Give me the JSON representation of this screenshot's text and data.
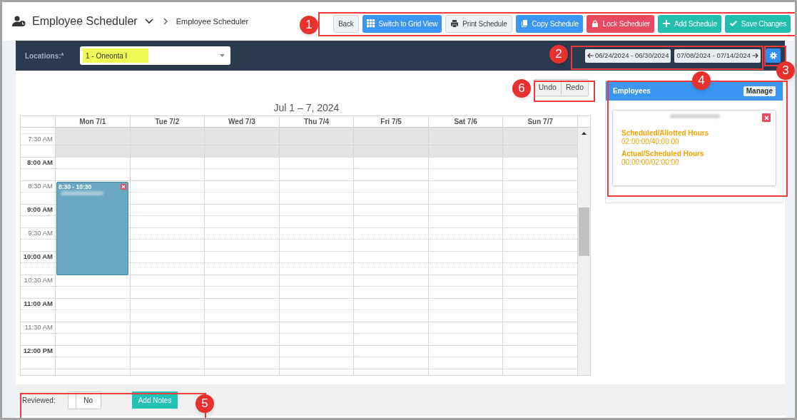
{
  "header": {
    "title": "Employee Scheduler",
    "breadcrumb": "Employee Scheduler"
  },
  "toolbar": [
    {
      "label": "Back",
      "kind": "plain"
    },
    {
      "label": "Switch to Grid View",
      "kind": "primary"
    },
    {
      "label": "Print Schedule",
      "kind": "light"
    },
    {
      "label": "Copy Schedule",
      "kind": "primary"
    },
    {
      "label": "Lock Scheduler",
      "kind": "danger"
    },
    {
      "label": "Add Schedule",
      "kind": "success"
    },
    {
      "label": "Save Changes",
      "kind": "success"
    }
  ],
  "filters": {
    "label": "Locations:*",
    "location": "1 - Oneonta I"
  },
  "date_nav": {
    "previous": "06/24/2024 - 06/30/2024",
    "next": "07/08/2024 - 07/14/2024"
  },
  "history": [
    "Undo",
    "Redo"
  ],
  "calendar": {
    "title": "Jul 1 – 7, 2024",
    "days": [
      {
        "label": "Mon 7/1",
        "events": [
          {
            "time": "8:30 - 10:30"
          }
        ]
      },
      {
        "label": "Tue 7/2"
      },
      {
        "label": "Wed 7/3"
      },
      {
        "label": "Thu 7/4"
      },
      {
        "label": "Fri 7/5"
      },
      {
        "label": "Sat 7/6"
      },
      {
        "label": "Sun 7/7"
      }
    ],
    "slots": [
      {
        "label": "7:30 AM",
        "kind": "half",
        "shaded": true
      },
      {
        "label": "8:00 AM",
        "kind": "hour",
        "shaded": false
      },
      {
        "label": "8:30 AM",
        "kind": "half",
        "shaded": false
      },
      {
        "label": "9:00 AM",
        "kind": "hour",
        "shaded": false
      },
      {
        "label": "9:30 AM",
        "kind": "half",
        "shaded": false
      },
      {
        "label": "10:00 AM",
        "kind": "hour",
        "shaded": false
      },
      {
        "label": "10:30 AM",
        "kind": "half",
        "shaded": false
      },
      {
        "label": "11:00 AM",
        "kind": "hour",
        "shaded": false
      },
      {
        "label": "11:30 AM",
        "kind": "half",
        "shaded": false
      },
      {
        "label": "12:00 PM",
        "kind": "hour",
        "shaded": false
      }
    ]
  },
  "employees": {
    "title": "Employees",
    "manage": "Manage",
    "cards": [
      {
        "stats": [
          {
            "label": "Scheduled/Allotted Hours",
            "value": "02:00:00/40:00:00"
          },
          {
            "label": "Actual/Scheduled Hours",
            "value": "00:00:00/02:00:00"
          }
        ]
      }
    ]
  },
  "review": {
    "label": "Reviewed:",
    "value": "No",
    "on": false,
    "notes": "Add Notes"
  },
  "callouts": [
    "1",
    "2",
    "3",
    "4",
    "5",
    "6"
  ]
}
